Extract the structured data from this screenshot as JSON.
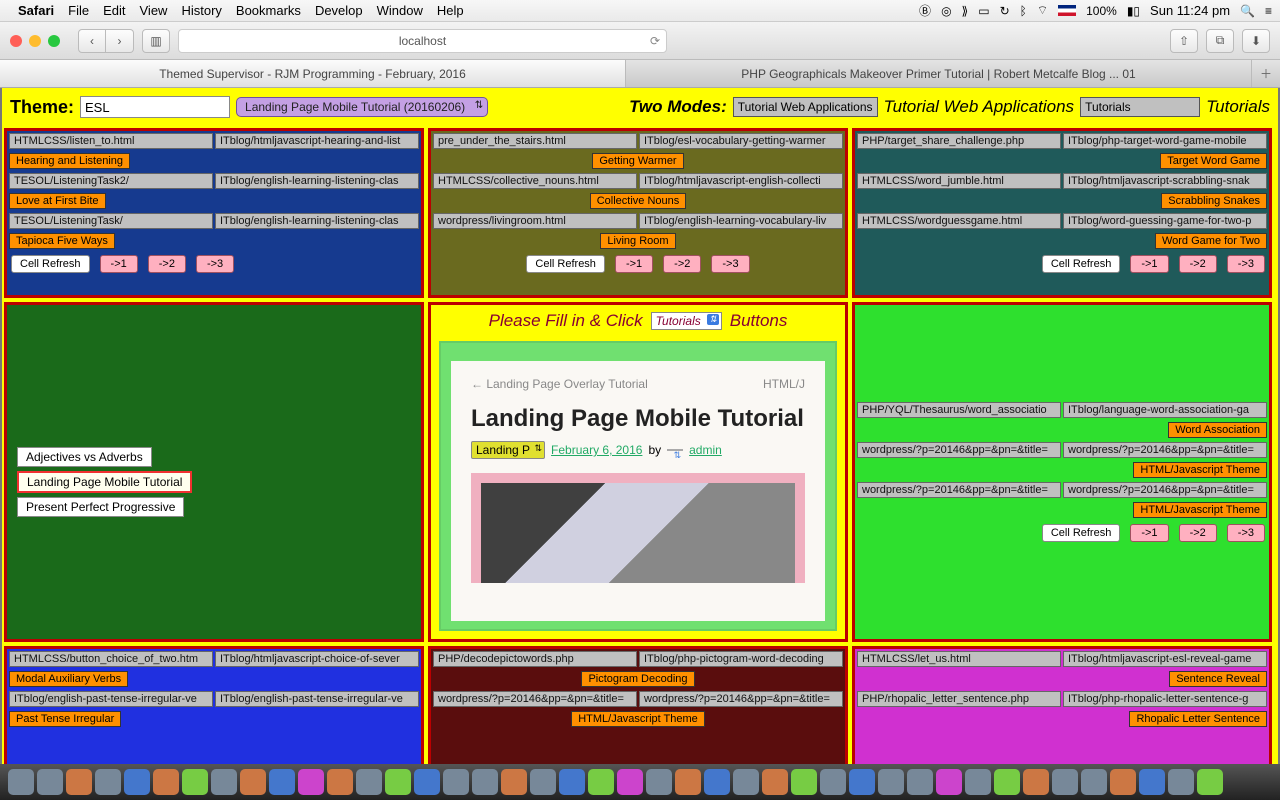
{
  "menubar": {
    "app": "Safari",
    "items": [
      "File",
      "Edit",
      "View",
      "History",
      "Bookmarks",
      "Develop",
      "Window",
      "Help"
    ],
    "battery": "100%",
    "clock": "Sun 11:24 pm"
  },
  "browser": {
    "url": "localhost",
    "tabs": [
      "Themed Supervisor - RJM Programming - February, 2016",
      "PHP Geographicals Makeover Primer Tutorial | Robert Metcalfe Blog ... 01"
    ]
  },
  "header": {
    "theme_label": "Theme:",
    "theme_value": "ESL",
    "select_value": "Landing Page Mobile Tutorial (20160206)",
    "modes_label": "Two Modes:",
    "mode1_box": "Tutorial Web Applications",
    "mode1_txt": "Tutorial Web Applications",
    "mode2_box": "Tutorials",
    "mode2_txt": "Tutorials"
  },
  "cells": {
    "c1": {
      "rows": [
        [
          "HTMLCSS/listen_to.html",
          "ITblog/htmljavascript-hearing-and-list"
        ],
        [
          "Hearing and Listening"
        ],
        [
          "TESOL/ListeningTask2/",
          "ITblog/english-learning-listening-clas"
        ],
        [
          "Love at First Bite"
        ],
        [
          "TESOL/ListeningTask/",
          "ITblog/english-learning-listening-clas"
        ],
        [
          "Tapioca Five Ways"
        ]
      ],
      "btns": [
        "Cell Refresh",
        "->1",
        "->2",
        "->3"
      ]
    },
    "c2": {
      "rows": [
        [
          "pre_under_the_stairs.html",
          "ITblog/esl-vocabulary-getting-warmer"
        ],
        [
          "Getting Warmer"
        ],
        [
          "HTMLCSS/collective_nouns.html",
          "ITblog/htmljavascript-english-collecti"
        ],
        [
          "Collective Nouns"
        ],
        [
          "wordpress/livingroom.html",
          "ITblog/english-learning-vocabulary-liv"
        ],
        [
          "Living Room"
        ]
      ],
      "btns": [
        "Cell Refresh",
        "->1",
        "->2",
        "->3"
      ]
    },
    "c3": {
      "rows": [
        [
          "PHP/target_share_challenge.php",
          "ITblog/php-target-word-game-mobile"
        ],
        [
          "Target Word Game"
        ],
        [
          "HTMLCSS/word_jumble.html",
          "ITblog/htmljavascript-scrabbling-snak"
        ],
        [
          "Scrabbling Snakes"
        ],
        [
          "HTMLCSS/wordguessgame.html",
          "ITblog/word-guessing-game-for-two-p"
        ],
        [
          "Word Game for Two"
        ]
      ],
      "btns": [
        "Cell Refresh",
        "->1",
        "->2",
        "->3"
      ]
    },
    "c4": {
      "items": [
        "Adjectives vs Adverbs",
        "Landing Page Mobile Tutorial",
        "Present Perfect Progressive"
      ],
      "active": 1
    },
    "c5": {
      "prompt1": "Please Fill in & Click",
      "select": "Tutorials",
      "prompt2": "Buttons",
      "breadcrumb_left": "← Landing Page Overlay Tutorial",
      "breadcrumb_right": "HTML/J",
      "title": "Landing Page Mobile Tutorial",
      "pill": "Landing P",
      "date": "February 6, 2016",
      "by": "by",
      "author": "admin"
    },
    "c6": {
      "rows": [
        [
          "PHP/YQL/Thesaurus/word_associatio",
          "ITblog/language-word-association-ga"
        ],
        [
          "Word Association"
        ],
        [
          "wordpress/?p=20146&pp=&pn=&title=",
          "wordpress/?p=20146&pp=&pn=&title="
        ],
        [
          "HTML/Javascript Theme"
        ],
        [
          "wordpress/?p=20146&pp=&pn=&title=",
          "wordpress/?p=20146&pp=&pn=&title="
        ],
        [
          "HTML/Javascript Theme"
        ]
      ],
      "btns": [
        "Cell Refresh",
        "->1",
        "->2",
        "->3"
      ]
    },
    "c7": {
      "rows": [
        [
          "HTMLCSS/button_choice_of_two.htm",
          "ITblog/htmljavascript-choice-of-sever"
        ],
        [
          "Modal Auxiliary Verbs"
        ],
        [
          "ITblog/english-past-tense-irregular-ve",
          "ITblog/english-past-tense-irregular-ve"
        ],
        [
          "Past Tense Irregular"
        ]
      ]
    },
    "c8": {
      "rows": [
        [
          "PHP/decodepictowords.php",
          "ITblog/php-pictogram-word-decoding"
        ],
        [
          "Pictogram Decoding"
        ],
        [
          "wordpress/?p=20146&pp=&pn=&title=",
          "wordpress/?p=20146&pp=&pn=&title="
        ],
        [
          "HTML/Javascript Theme"
        ]
      ]
    },
    "c9": {
      "rows": [
        [
          "HTMLCSS/let_us.html",
          "ITblog/htmljavascript-esl-reveal-game"
        ],
        [
          "Sentence Reveal"
        ],
        [
          "PHP/rhopalic_letter_sentence.php",
          "ITblog/php-rhopalic-letter-sentence-g"
        ],
        [
          "Rhopalic Letter Sentence"
        ]
      ]
    }
  }
}
